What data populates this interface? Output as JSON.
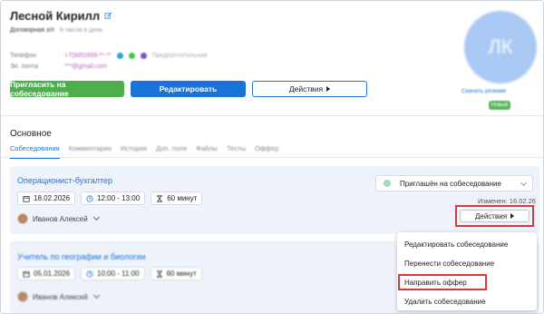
{
  "candidate": {
    "name": "Лесной Кирилл",
    "contract": "Договорная з/п",
    "contract_note": "6 часов в день",
    "avatar_initials": "ЛК",
    "download_resume": "Скачать резюме",
    "status_badge": "Новый",
    "contacts": [
      {
        "label": "Телефон",
        "value": "+7(985)999-**-**",
        "preferred": "Предпочтительная"
      },
      {
        "label": "Эл. почта",
        "value": "***@gmail.com"
      }
    ]
  },
  "buttons": {
    "invite": "Пригласить на собеседование",
    "edit": "Редактировать",
    "actions": "Действия"
  },
  "section": {
    "title": "Основное",
    "tabs": [
      "Собеседования",
      "Комментарии",
      "История",
      "Доп. поля",
      "Файлы",
      "Тесты",
      "Оффер"
    ]
  },
  "interviews": [
    {
      "vacancy": "Операционист-бухгалтер",
      "date": "18.02.2026",
      "time": "12:00 - 13:00",
      "duration": "60 минут",
      "interviewer": "Иванов Алексей",
      "status": "Приглашён на собеседование",
      "changed": "Изменен: 16.02.26",
      "actions": "Действия"
    },
    {
      "vacancy": "Учитель по географии и биологии",
      "date": "05.01.2026",
      "time": "10:00 - 11:00",
      "duration": "60 минут",
      "interviewer": "Иванов Алексей"
    }
  ],
  "menu": {
    "items": [
      "Редактировать собеседование",
      "Перенести собеседование",
      "Направить оффер",
      "Удалить собеседование"
    ]
  },
  "colors": {
    "accent": "#1a73d9",
    "green": "#4cae4c",
    "highlight": "#d9383a",
    "card_bg": "#eef3fb"
  }
}
